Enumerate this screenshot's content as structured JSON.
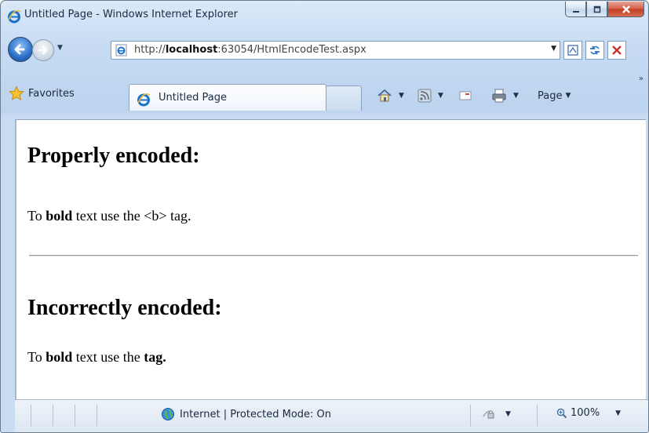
{
  "window": {
    "title": "Untitled Page - Windows Internet Explorer"
  },
  "address_bar": {
    "url_prefix": "http://",
    "url_host": "localhost",
    "url_rest": ":63054/HtmlEncodeTest.aspx"
  },
  "favorites_bar": {
    "favorites_label": "Favorites",
    "tab_label": "Untitled Page",
    "page_menu_label": "Page"
  },
  "content": {
    "heading_proper": "Properly encoded:",
    "proper_text_before": "To ",
    "proper_text_bold": "bold",
    "proper_text_after": " text use the <b> tag.",
    "heading_incorrect": "Incorrectly encoded:",
    "incorrect_text_before": "To ",
    "incorrect_text_bold": "bold",
    "incorrect_text_middle": " text use the ",
    "incorrect_text_tag": "tag."
  },
  "status_bar": {
    "zone_text": "Internet | Protected Mode: On",
    "zoom_text": "100%"
  },
  "colors": {
    "chrome_blue": "#c6dbf3",
    "close_red": "#c23c22",
    "ie_blue": "#1a73c9"
  }
}
